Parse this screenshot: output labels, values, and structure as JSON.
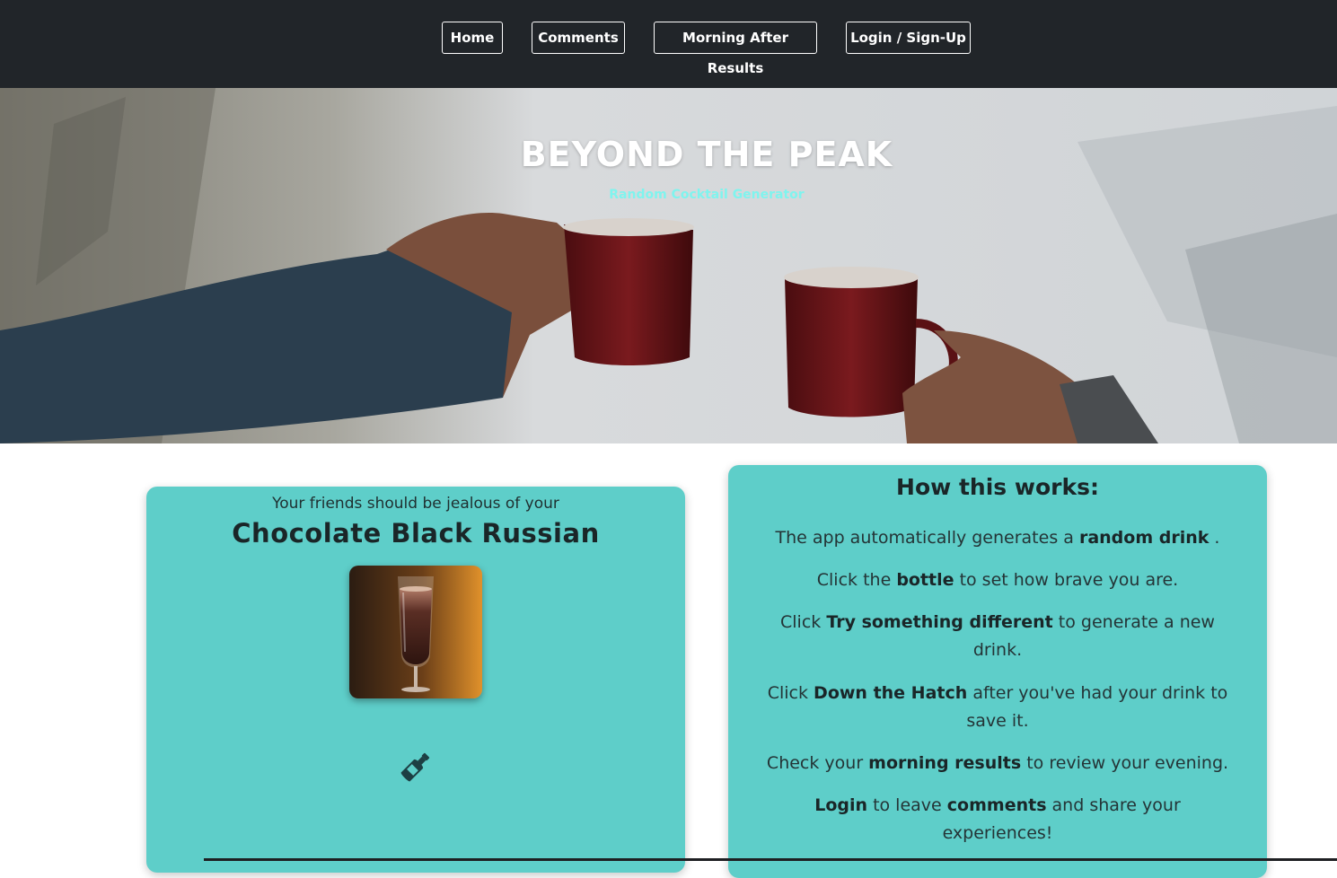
{
  "nav": {
    "home": "Home",
    "comments": "Comments",
    "morning": "Morning After Results",
    "login": "Login / Sign-Up"
  },
  "hero": {
    "title": "BEYOND THE PEAK",
    "subtitle": "Random Cocktail Generator"
  },
  "drink": {
    "intro": "Your friends should be jealous of your",
    "name": "Chocolate Black Russian",
    "image_icon": "cocktail-glass-photo",
    "bottle_icon": "bottle-icon"
  },
  "info": {
    "title": "How this works:",
    "p1": {
      "a": "The app automatically generates a ",
      "b": "random drink",
      "c": " ."
    },
    "p2": {
      "a": "Click the ",
      "b": "bottle",
      "c": " to set how brave you are."
    },
    "p3": {
      "a": "Click ",
      "b": "Try something different",
      "c": " to generate a new drink."
    },
    "p4": {
      "a": "Click ",
      "b": "Down the Hatch",
      "c": " after you've had your drink to save it."
    },
    "p5": {
      "a": "Check your ",
      "b": "morning results",
      "c": " to review your evening."
    },
    "p6": {
      "a": "",
      "b": "Login",
      "c": " to leave ",
      "d": "comments",
      "e": " and share your experiences!"
    }
  },
  "colors": {
    "navbar": "#212529",
    "card": "#5ecec9",
    "subtitle": "#7ff4ee"
  }
}
